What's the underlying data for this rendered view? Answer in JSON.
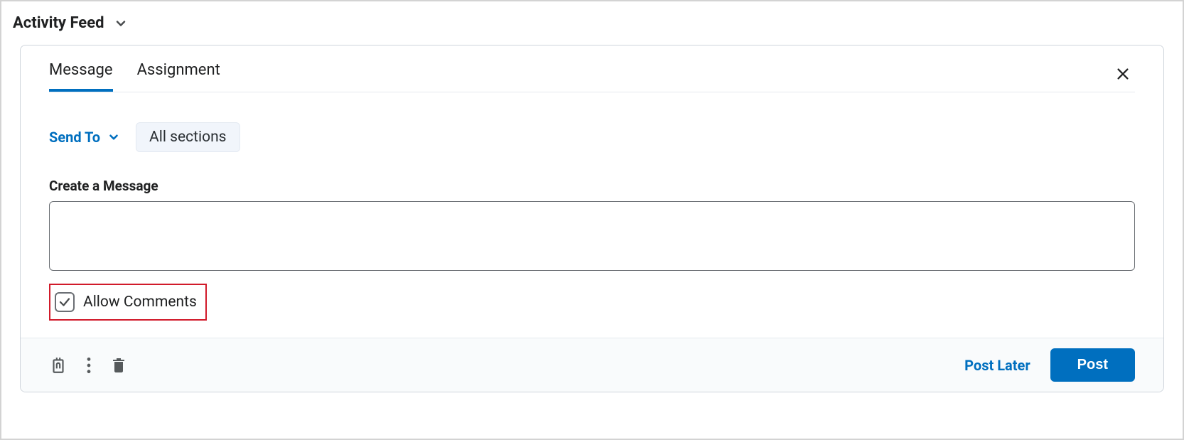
{
  "header": {
    "title": "Activity Feed"
  },
  "tabs": {
    "message": "Message",
    "assignment": "Assignment"
  },
  "sendTo": {
    "label": "Send To",
    "chip": "All sections"
  },
  "message": {
    "label": "Create a Message",
    "value": ""
  },
  "allowComments": {
    "label": "Allow Comments",
    "checked": true
  },
  "footer": {
    "postLater": "Post Later",
    "post": "Post"
  }
}
